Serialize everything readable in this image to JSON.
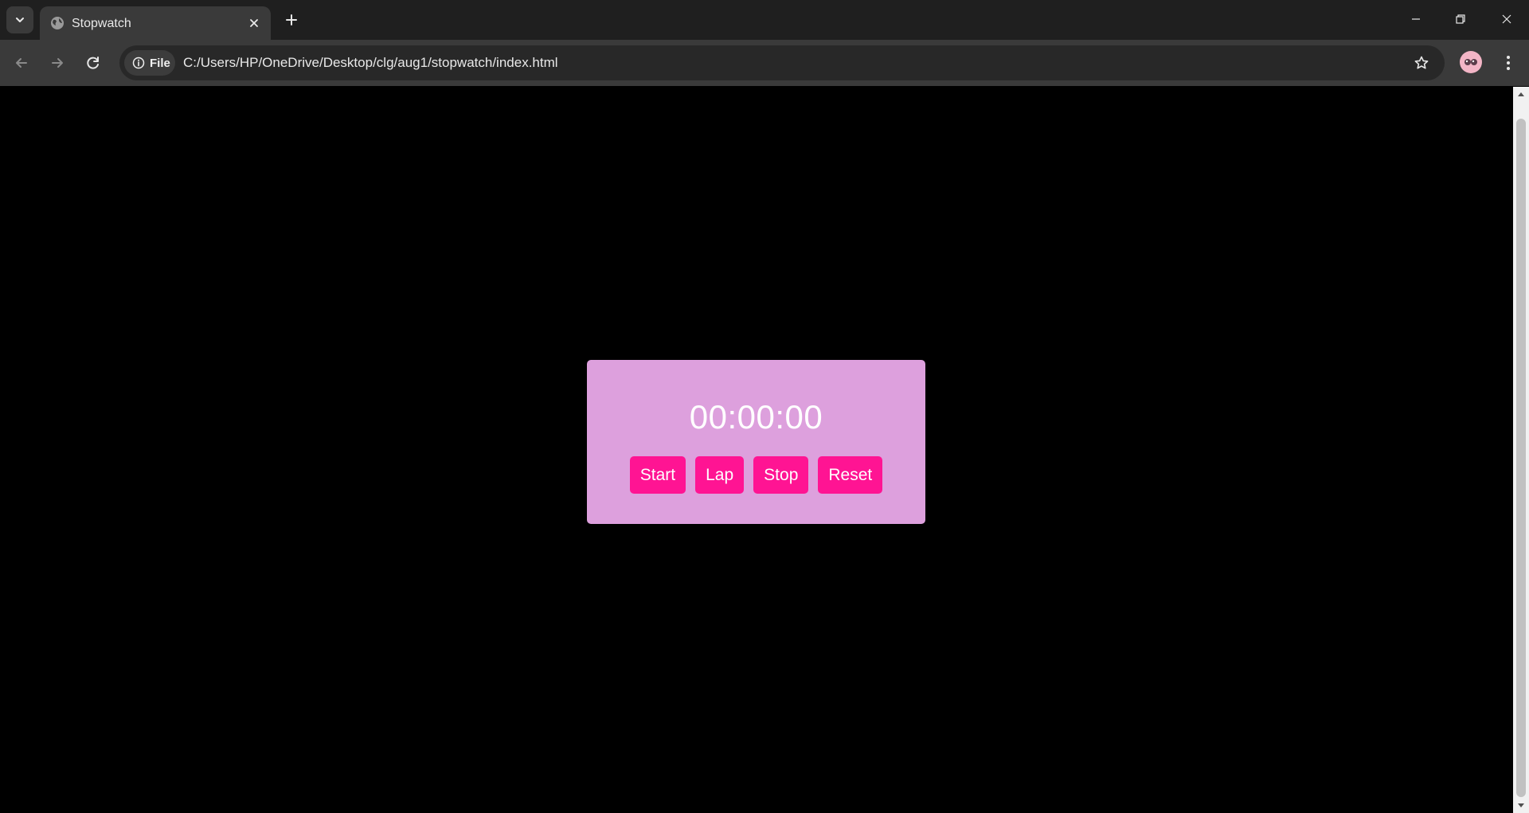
{
  "browser": {
    "tab": {
      "title": "Stopwatch",
      "favicon": "globe-icon"
    },
    "toolbar": {
      "site_chip_label": "File",
      "url": "C:/Users/HP/OneDrive/Desktop/clg/aug1/stopwatch/index.html"
    }
  },
  "stopwatch": {
    "time": "00:00:00",
    "buttons": {
      "start": "Start",
      "lap": "Lap",
      "stop": "Stop",
      "reset": "Reset"
    }
  },
  "colors": {
    "page_background": "#000000",
    "panel": "#dda0dd",
    "button": "#ff1493",
    "button_text": "#ffffff"
  }
}
